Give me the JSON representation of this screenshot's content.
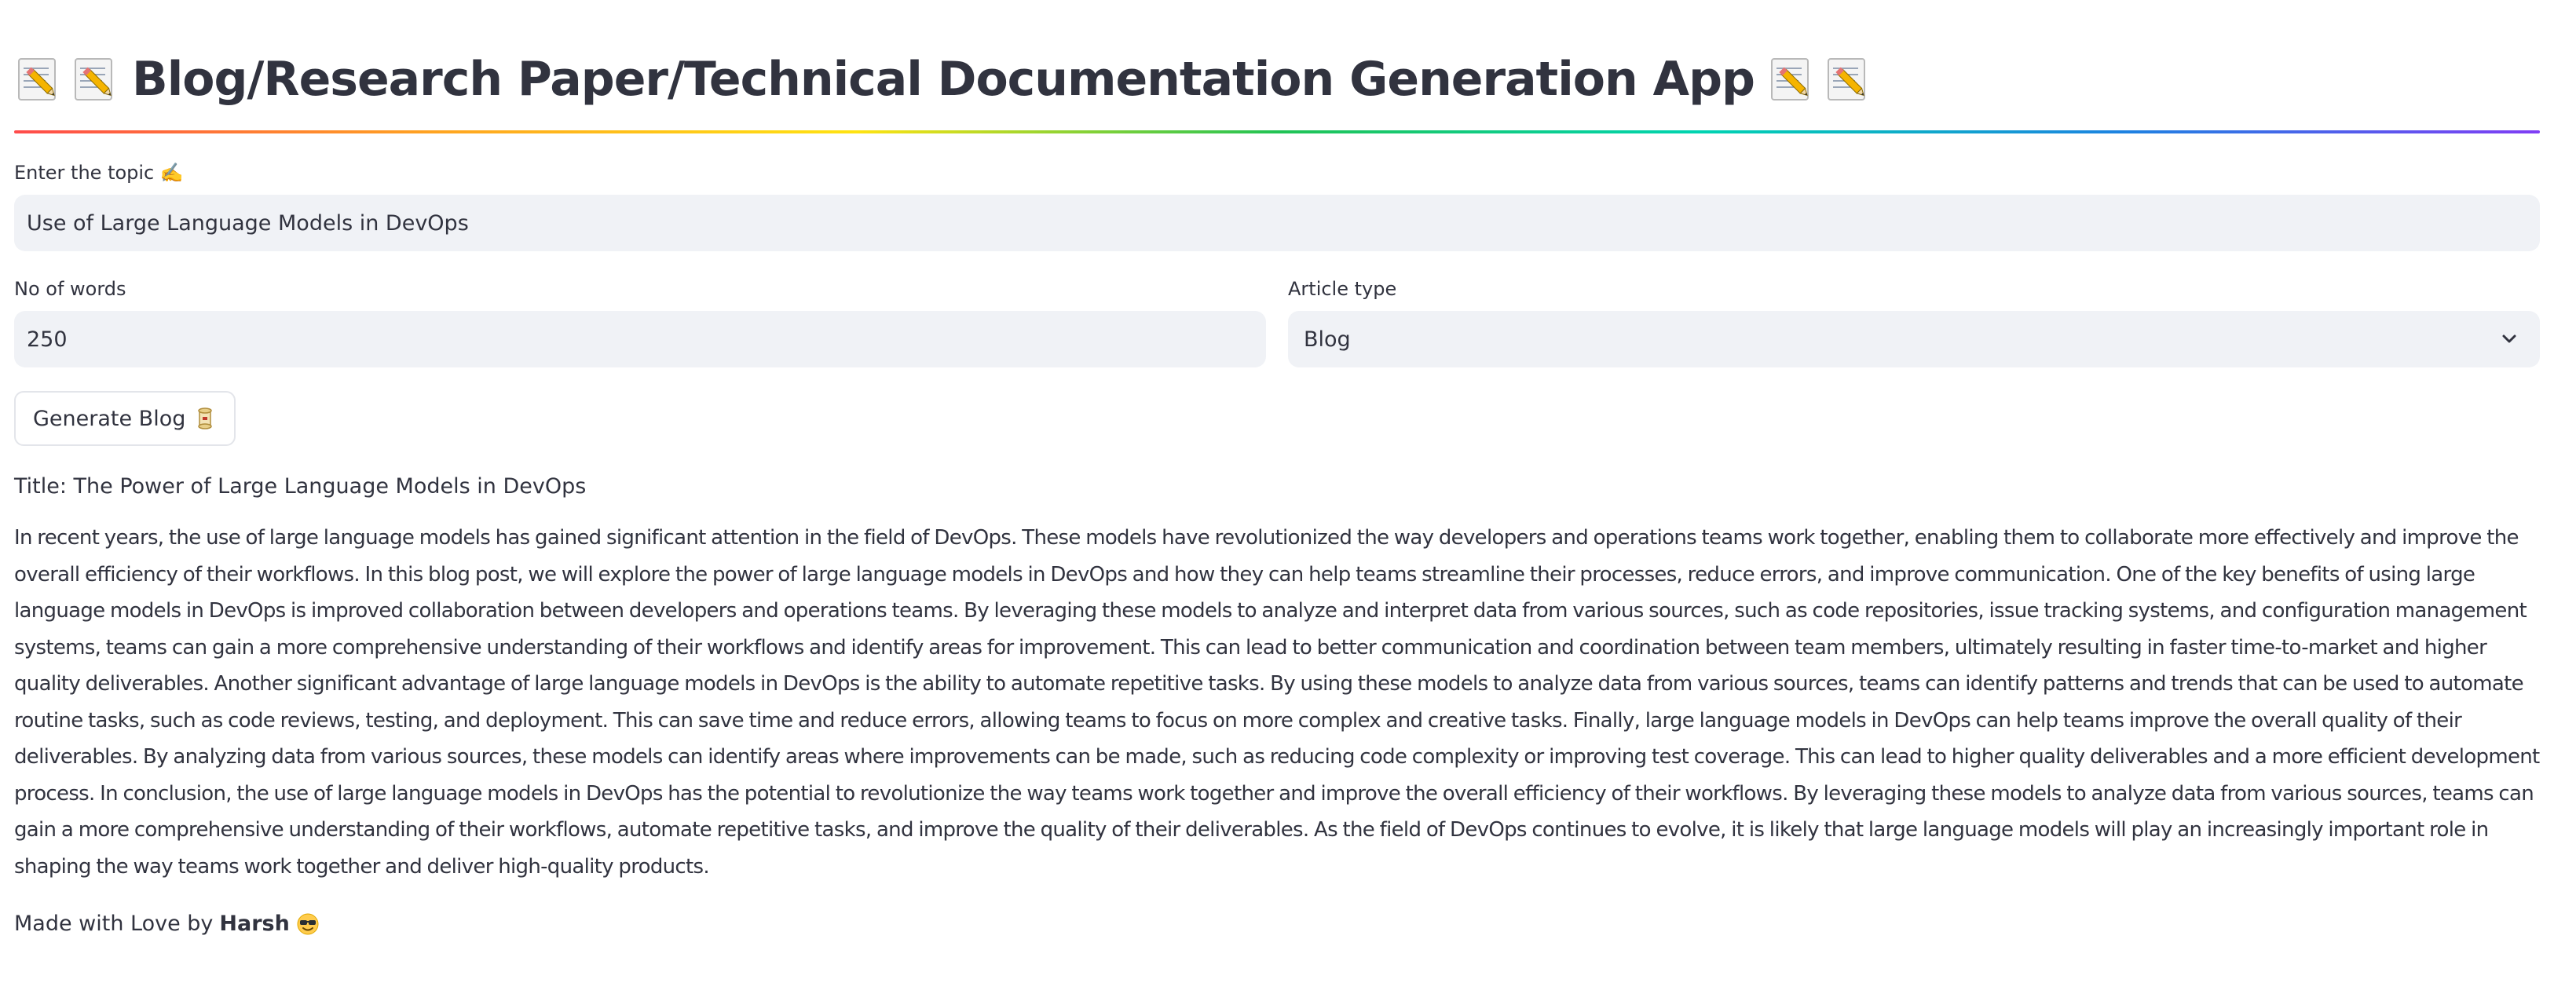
{
  "app": {
    "title": "Blog/Research Paper/Technical Documentation Generation App",
    "title_icon": "memo-icon"
  },
  "divider": {
    "colors": [
      "#ff4b4b",
      "#ffa421",
      "#ffe312",
      "#21c354",
      "#00d4b1",
      "#1c83e1",
      "#803df5"
    ]
  },
  "topic": {
    "label": "Enter the topic ✍️",
    "value": "Use of Large Language Models in DevOps"
  },
  "words": {
    "label": "No of words",
    "value": "250"
  },
  "article_type": {
    "label": "Article type",
    "selected": "Blog"
  },
  "generate_button": {
    "label": "Generate Blog",
    "icon": "rolled-paper-icon"
  },
  "article": {
    "title": "Title: The Power of Large Language Models in DevOps",
    "body": "In recent years, the use of large language models has gained significant attention in the field of DevOps. These models have revolutionized the way developers and operations teams work together, enabling them to collaborate more effectively and improve the overall efficiency of their workflows. In this blog post, we will explore the power of large language models in DevOps and how they can help teams streamline their processes, reduce errors, and improve communication. One of the key benefits of using large language models in DevOps is improved collaboration between developers and operations teams. By leveraging these models to analyze and interpret data from various sources, such as code repositories, issue tracking systems, and configuration management systems, teams can gain a more comprehensive understanding of their workflows and identify areas for improvement. This can lead to better communication and coordination between team members, ultimately resulting in faster time-to-market and higher quality deliverables. Another significant advantage of large language models in DevOps is the ability to automate repetitive tasks. By using these models to analyze data from various sources, teams can identify patterns and trends that can be used to automate routine tasks, such as code reviews, testing, and deployment. This can save time and reduce errors, allowing teams to focus on more complex and creative tasks. Finally, large language models in DevOps can help teams improve the overall quality of their deliverables. By analyzing data from various sources, these models can identify areas where improvements can be made, such as reducing code complexity or improving test coverage. This can lead to higher quality deliverables and a more efficient development process. In conclusion, the use of large language models in DevOps has the potential to revolutionize the way teams work together and improve the overall efficiency of their workflows. By leveraging these models to analyze data from various sources, teams can gain a more comprehensive understanding of their workflows, automate repetitive tasks, and improve the quality of their deliverables. As the field of DevOps continues to evolve, it is likely that large language models will play an increasingly important role in shaping the way teams work together and deliver high-quality products."
  },
  "footer": {
    "prefix": "Made with Love by",
    "author": "Harsh",
    "icon": "sunglasses-face-icon"
  }
}
